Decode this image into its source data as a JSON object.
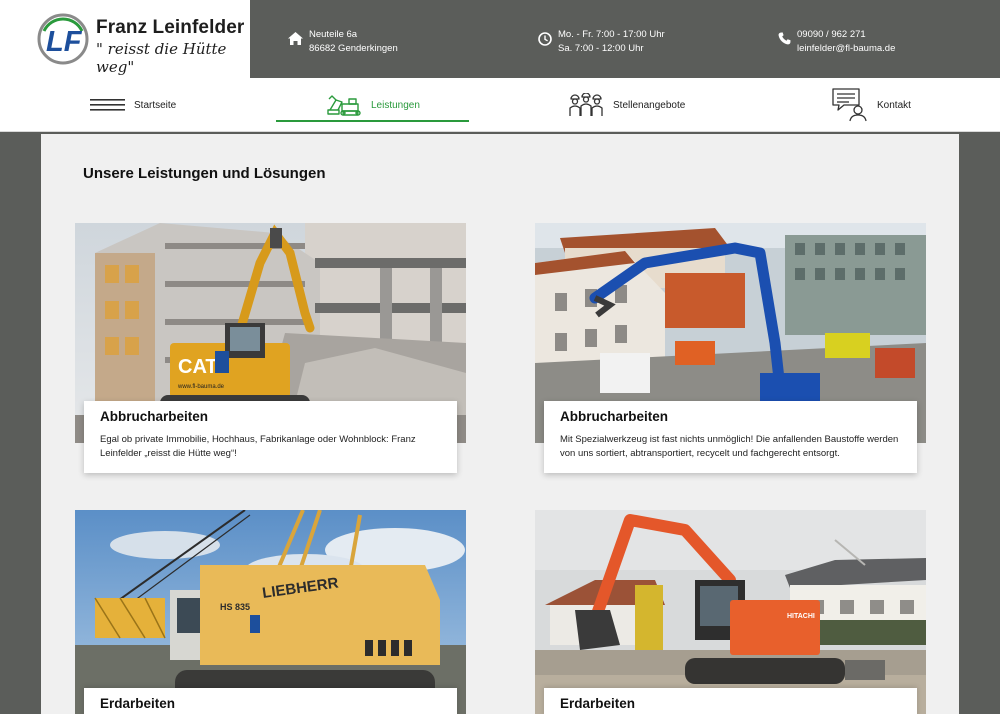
{
  "brand": {
    "name": "Franz Leinfelder",
    "slogan": "\" reisst die Hütte weg\"",
    "logo_letters": "LF"
  },
  "header": {
    "address": {
      "icon": "home-icon",
      "line1": "Neuteile 6a",
      "line2": "86682 Genderkingen"
    },
    "hours": {
      "icon": "clock-icon",
      "line1": "Mo. - Fr. 7:00 - 17:00 Uhr",
      "line2": "Sa. 7:00 - 12:00 Uhr"
    },
    "contact": {
      "icon": "phone-icon",
      "line1": "09090 / 962 271",
      "line2": "leinfelder@fl-bauma.de"
    }
  },
  "nav": {
    "items": [
      {
        "label": "Startseite",
        "icon": "hamburger-menu-icon",
        "active": false
      },
      {
        "label": "Leistungen",
        "icon": "excavator-icon",
        "active": true
      },
      {
        "label": "Stellenangebote",
        "icon": "workers-icon",
        "active": false
      },
      {
        "label": "Kontakt",
        "icon": "chat-person-icon",
        "active": false
      }
    ]
  },
  "page": {
    "title": "Unsere Leistungen und Lösungen"
  },
  "cards": [
    {
      "title": "Abbrucharbeiten",
      "text": " Egal ob private Immobilie, Hochhaus, Fabrikanlage oder Wohnblock: Franz Leinfelder „reisst die Hütte weg“!"
    },
    {
      "title": "Abbrucharbeiten",
      "text": "Mit Spezialwerkzeug ist fast nichts unmöglich! Die anfallenden Baustoffe werden von uns sortiert, abtransportiert, recycelt und fachgerecht entsorgt."
    },
    {
      "title": "Erdarbeiten",
      "text": ""
    },
    {
      "title": "Erdarbeiten",
      "text": ""
    }
  ],
  "images": {
    "card1_machine_brand": "CAT",
    "card1_machine_site": "www.fl-bauma.de",
    "card3_machine_brand": "LIEBHERR",
    "card3_machine_model": "HS 835",
    "card4_machine_brand": "HITACHI"
  },
  "colors": {
    "accent": "#2a9a3c",
    "header_bg": "#5b5d5a",
    "content_bg": "#f0f0f0",
    "logo_blue": "#1d4f9c"
  }
}
